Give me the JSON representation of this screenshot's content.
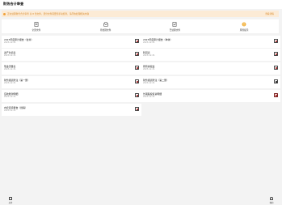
{
  "header": {
    "title": "财务合计审查"
  },
  "notice": {
    "text": "正在处理财务合计审查 共 8 份文件，部分文件需要您手动核查，请尽快处理相关内容",
    "link_label": "查看详情"
  },
  "quicknav": [
    {
      "label": "全部文件",
      "icon": "document-icon"
    },
    {
      "label": "待处理文件",
      "icon": "tray-icon"
    },
    {
      "label": "已处理文件",
      "icon": "checked-document-icon"
    },
    {
      "label": "风险提示",
      "icon": "warning-icon"
    }
  ],
  "cards": [
    {
      "name": "2023年度审计报告（合并）",
      "sub": "2023-12-31"
    },
    {
      "name": "2023年度审计报告（单体）",
      "sub": "2023-12-31"
    },
    {
      "name": "资产负债表",
      "sub": "2023-12-31"
    },
    {
      "name": "利润表",
      "sub": "2023-12-31"
    },
    {
      "name": "现金流量表",
      "sub": "2023-12-31"
    },
    {
      "name": "所有者权益",
      "sub": "2023-12-31"
    },
    {
      "name": "财务报表附注（第一册）",
      "sub": "2023-12-31"
    },
    {
      "name": "财务报表附注（第二册）",
      "sub": "2023-12-31"
    },
    {
      "name": "应收账款明细",
      "sub": "2023-12-31"
    },
    {
      "name": "长期股权投资明细",
      "sub": "2023-12-31"
    },
    {
      "name": "内控自评报告（终稿）",
      "sub": "2023-12-31"
    }
  ],
  "bottombar": {
    "left_label": "文件",
    "right_label": "我的"
  }
}
